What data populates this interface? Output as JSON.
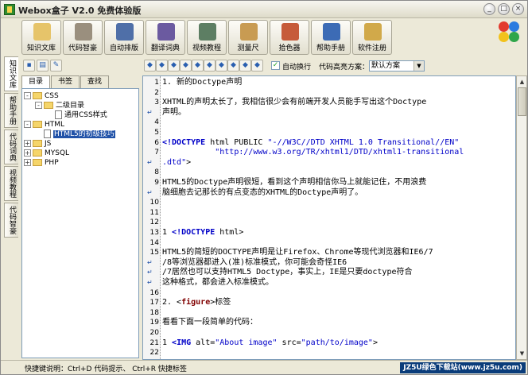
{
  "window": {
    "title": "Webox盒子 V2.0 免费体验版",
    "controls": [
      "_",
      "□",
      "×"
    ]
  },
  "toolbar": [
    {
      "label": "知识文库",
      "icon": "book-icon",
      "color": "#e6c46a"
    },
    {
      "label": "代码智豪",
      "icon": "pen-icon",
      "color": "#9a8f7e"
    },
    {
      "label": "自动排版",
      "icon": "layout-icon",
      "color": "#4f6fa8"
    },
    {
      "label": "翻译词典",
      "icon": "translate-icon",
      "color": "#6b5aa0"
    },
    {
      "label": "视频教程",
      "icon": "video-icon",
      "color": "#5d7e63"
    },
    {
      "label": "测量尺",
      "icon": "ruler-icon",
      "color": "#c89b52"
    },
    {
      "label": "拾色器",
      "icon": "palette-icon",
      "color": "#c65b3a"
    },
    {
      "label": "帮助手册",
      "icon": "help-icon",
      "color": "#3c6bb5"
    },
    {
      "label": "软件注册",
      "icon": "lock-icon",
      "color": "#d1a94a"
    }
  ],
  "vertical_tabs": [
    "知识文库",
    "帮助手册",
    "代码词典",
    "视频教程",
    "代码智豪"
  ],
  "left": {
    "tabs": [
      "目录",
      "书签",
      "查找"
    ],
    "tree": [
      {
        "label": "CSS",
        "level": 0,
        "type": "folder",
        "exp": "-"
      },
      {
        "label": "二级目录",
        "level": 1,
        "type": "folder",
        "exp": "-"
      },
      {
        "label": "通用CSS样式",
        "level": 2,
        "type": "doc",
        "exp": ""
      },
      {
        "label": "HTML",
        "level": 0,
        "type": "folder",
        "exp": "-"
      },
      {
        "label": "HTML5的初级技巧",
        "level": 1,
        "type": "doc",
        "exp": "",
        "selected": true
      },
      {
        "label": "JS",
        "level": 0,
        "type": "folder",
        "exp": "+"
      },
      {
        "label": "MYSQL",
        "level": 0,
        "type": "folder",
        "exp": "+"
      },
      {
        "label": "PHP",
        "level": 0,
        "type": "folder",
        "exp": "+"
      }
    ]
  },
  "right": {
    "auto_wrap_label": "自动换行",
    "highlight_label": "代码高亮方案：",
    "highlight_value": "默认方案"
  },
  "editor_lines": [
    {
      "n": "1",
      "html": "1. 新的Doctype声明"
    },
    {
      "n": "2",
      "html": ""
    },
    {
      "n": "3",
      "html": "XHTML的声明太长了，我相信很少会有前端开发人员能手写出这个Doctype"
    },
    {
      "n": "",
      "wrap": true,
      "html": "声明。"
    },
    {
      "n": "4",
      "html": ""
    },
    {
      "n": "5",
      "html": ""
    },
    {
      "n": "6",
      "html": "<span class='tag'>&lt;!DOCTYPE</span> html PUBLIC <span class='str'>\"-//W3C//DTD XHTML 1.0 Transitional//EN\"</span>"
    },
    {
      "n": "7",
      "html": "           <span class='str'>\"http://www.w3.org/TR/xhtml1/DTD/xhtml1-transitional</span>"
    },
    {
      "n": "",
      "wrap": true,
      "html": "<span class='str'>.dtd\"</span>&gt;"
    },
    {
      "n": "8",
      "html": ""
    },
    {
      "n": "9",
      "html": "HTML5的Doctype声明很短，看到这个声明相信你马上就能记住，不用浪费"
    },
    {
      "n": "",
      "wrap": true,
      "html": "脑细胞去记那长的有点变态的XHTML的Doctype声明了。"
    },
    {
      "n": "10",
      "html": ""
    },
    {
      "n": "11",
      "html": ""
    },
    {
      "n": "12",
      "html": ""
    },
    {
      "n": "13",
      "html": "1 <span class='tag'>&lt;!DOCTYPE</span> html&gt;"
    },
    {
      "n": "14",
      "html": ""
    },
    {
      "n": "15",
      "html": "HTML5的简短的DOCTYPE声明是让Firefox、Chrome等现代浏览器和IE6/7"
    },
    {
      "n": "",
      "wrap": true,
      "html": "/8等浏览器都进入(准)标准模式，你可能会奇怪IE6"
    },
    {
      "n": "",
      "wrap": true,
      "html": "/7居然也可以支持HTML5 Doctype，事实上，IE是只要doctype符合"
    },
    {
      "n": "",
      "wrap": true,
      "html": "这种格式，都会进入标准模式。"
    },
    {
      "n": "16",
      "html": ""
    },
    {
      "n": "17",
      "html": "2. &lt;<span class='kw'>figure</span>&gt;标签"
    },
    {
      "n": "18",
      "html": ""
    },
    {
      "n": "19",
      "html": "看看下面一段简单的代码："
    },
    {
      "n": "20",
      "html": ""
    },
    {
      "n": "21",
      "html": "1 <span class='tag'>&lt;IMG</span> alt=<span class='str'>\"About image\"</span> src=<span class='str'>\"path/to/image\"</span>&gt;"
    },
    {
      "n": "22",
      "html": ""
    }
  ],
  "status": {
    "text": "快捷键说明：Ctrl+D 代码提示、  Ctrl+R 快捷标签",
    "watermark": "JZ5U绿色下载站(www.jz5u.com)"
  }
}
